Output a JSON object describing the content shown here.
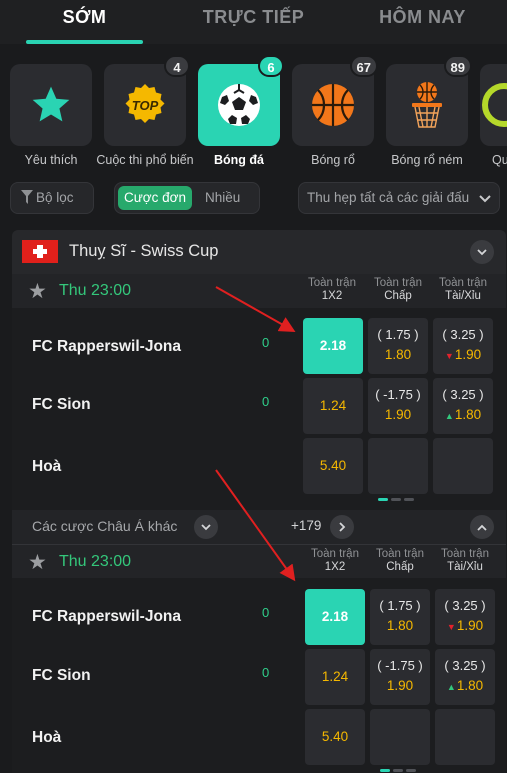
{
  "tabs": [
    {
      "label": "SỚM",
      "active": true
    },
    {
      "label": "TRỰC TIẾP",
      "active": false
    },
    {
      "label": "HÔM NAY",
      "active": false
    }
  ],
  "sports": [
    {
      "label": "Yêu thích",
      "icon": "star-icon",
      "badge": ""
    },
    {
      "label": "Cuộc thi phổ biến",
      "icon": "top-badge-icon",
      "badge": "4",
      "icon_text": "TOP"
    },
    {
      "label": "Bóng đá",
      "icon": "soccer-ball-icon",
      "badge": "6",
      "active": true
    },
    {
      "label": "Bóng rổ",
      "icon": "basketball-icon",
      "badge": "67"
    },
    {
      "label": "Bóng rổ ném",
      "icon": "basketball-hoop-icon",
      "badge": "89"
    },
    {
      "label": "Qu",
      "icon": "partial-sport-icon",
      "badge": ""
    }
  ],
  "filters": {
    "filter_label": "Bộ lọc",
    "single_label": "Cược đơn",
    "multi_label": "Nhiều",
    "league_select": "Thu hẹp tất cả các giải đấu"
  },
  "league": {
    "name": "Thuỵ Sĩ - Swiss Cup"
  },
  "columns": [
    {
      "top": "Toàn trận",
      "bottom": "1X2"
    },
    {
      "top": "Toàn trận",
      "bottom": "Chấp"
    },
    {
      "top": "Toàn trận",
      "bottom": "Tài/Xỉu"
    }
  ],
  "events": [
    {
      "time": "Thu 23:00",
      "rows": [
        {
          "team": "FC Rapperswil-Jona",
          "score": "0",
          "x12": "2.18",
          "handicap_line": "( 1.75 )",
          "handicap_odd": "1.80",
          "ou_line": "( 3.25 )",
          "ou_odd": "1.90",
          "ou_trend": "down"
        },
        {
          "team": "FC Sion",
          "score": "0",
          "x12": "1.24",
          "handicap_line": "( -1.75 )",
          "handicap_odd": "1.90",
          "ou_line": "( 3.25 )",
          "ou_odd": "1.80",
          "ou_trend": "up"
        },
        {
          "team": "Hoà",
          "score": "",
          "x12": "5.40",
          "handicap_line": "",
          "handicap_odd": "",
          "ou_line": "",
          "ou_odd": "",
          "ou_trend": ""
        }
      ]
    },
    {
      "time": "Thu 23:00",
      "rows": [
        {
          "team": "FC Rapperswil-Jona",
          "score": "0",
          "x12": "2.18",
          "handicap_line": "( 1.75 )",
          "handicap_odd": "1.80",
          "ou_line": "( 3.25 )",
          "ou_odd": "1.90",
          "ou_trend": "down"
        },
        {
          "team": "FC Sion",
          "score": "0",
          "x12": "1.24",
          "handicap_line": "( -1.75 )",
          "handicap_odd": "1.90",
          "ou_line": "( 3.25 )",
          "ou_odd": "1.80",
          "ou_trend": "up"
        },
        {
          "team": "Hoà",
          "score": "",
          "x12": "5.40",
          "handicap_line": "",
          "handicap_odd": "",
          "ou_line": "",
          "ou_odd": "",
          "ou_trend": ""
        }
      ]
    }
  ],
  "other_bets": {
    "label": "Các cược Châu Á khác",
    "count": "+179"
  },
  "colors": {
    "accent": "#2ad4b3",
    "green": "#27a96c",
    "odds": "#f5b800",
    "annotation_arrow": "#e02020"
  }
}
